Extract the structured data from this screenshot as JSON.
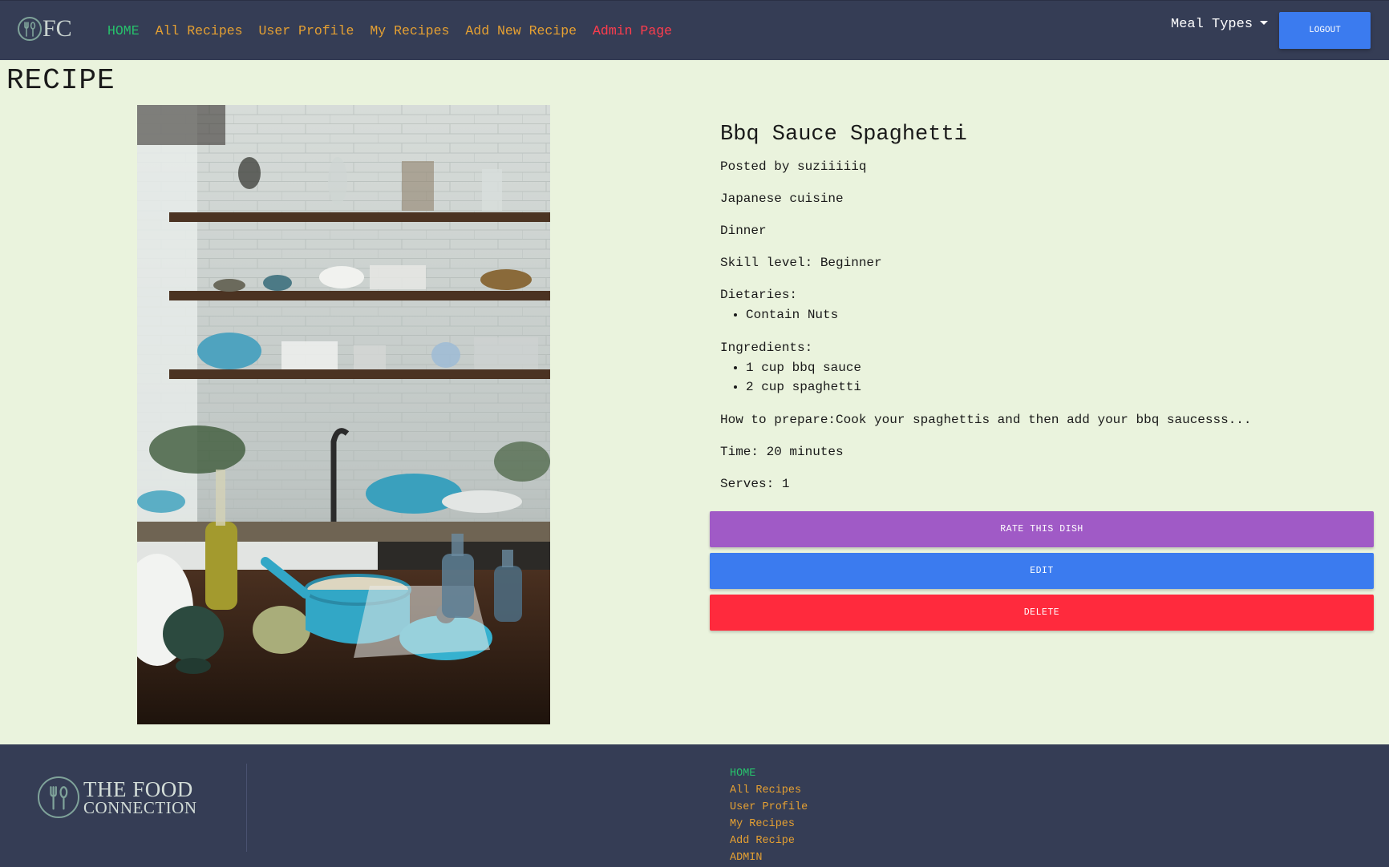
{
  "nav": {
    "logo_text": "FC",
    "links": [
      "HOME",
      "All Recipes",
      "User Profile",
      "My Recipes",
      "Add New Recipe",
      "Admin Page"
    ],
    "meal_types_label": "Meal Types",
    "logout_label": "LOGOUT"
  },
  "page": {
    "title": "RECIPE"
  },
  "recipe": {
    "name": "Bbq Sauce Spaghetti",
    "posted_by": "Posted by suziiiiiq",
    "cuisine": "Japanese cuisine",
    "meal": "Dinner",
    "skill": "Skill level: Beginner",
    "dietaries_label": "Dietaries:",
    "dietaries": [
      "Contain Nuts"
    ],
    "ingredients_label": "Ingredients:",
    "ingredients": [
      "1 cup bbq sauce",
      "2 cup spaghetti"
    ],
    "prepare": "How to prepare:Cook your spaghettis and then add your bbq saucesss...",
    "time": "Time: 20 minutes",
    "serves": "Serves: 1"
  },
  "actions": {
    "rate_label": "RATE THIS DISH",
    "edit_label": "EDIT",
    "delete_label": "DELETE"
  },
  "footer": {
    "brand_line1": "THE FOOD",
    "brand_line2": "CONNECTION",
    "links": [
      "HOME",
      "All Recipes",
      "User Profile",
      "My Recipes",
      "Add Recipe",
      "ADMIN"
    ]
  },
  "colors": {
    "navbar_bg": "#353d55",
    "page_bg": "#eaf3dd",
    "link_orange": "#e5a032",
    "link_home_green": "#27c26c",
    "link_admin_red": "#ff3d4d",
    "button_blue": "#3b7bef",
    "button_purple": "#a05ac6",
    "button_red": "#ff2a3d"
  },
  "icons": {
    "logo": "fork-spoon-circle-icon",
    "dropdown": "caret-down-icon"
  }
}
